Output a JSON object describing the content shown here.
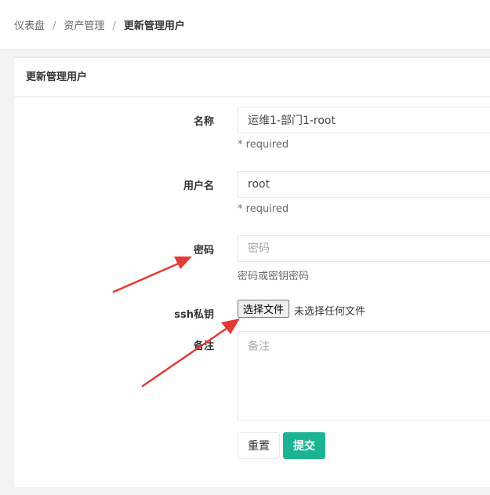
{
  "breadcrumb": {
    "items": [
      "仪表盘",
      "资产管理"
    ],
    "current": "更新管理用户",
    "separator": "/"
  },
  "panel": {
    "title": "更新管理用户"
  },
  "form": {
    "name": {
      "label": "名称",
      "value": "运维1-部门1-root",
      "help": "* required"
    },
    "username": {
      "label": "用户名",
      "value": "root",
      "help": "* required"
    },
    "password": {
      "label": "密码",
      "placeholder": "密码",
      "help": "密码或密钥密码"
    },
    "ssh_key": {
      "label": "ssh私钥",
      "button_label": "选择文件",
      "status": "未选择任何文件"
    },
    "comment": {
      "label": "备注",
      "placeholder": "备注"
    }
  },
  "buttons": {
    "reset": "重置",
    "submit": "提交"
  },
  "colors": {
    "primary": "#1ab394",
    "annotation_arrow": "#e53935"
  }
}
